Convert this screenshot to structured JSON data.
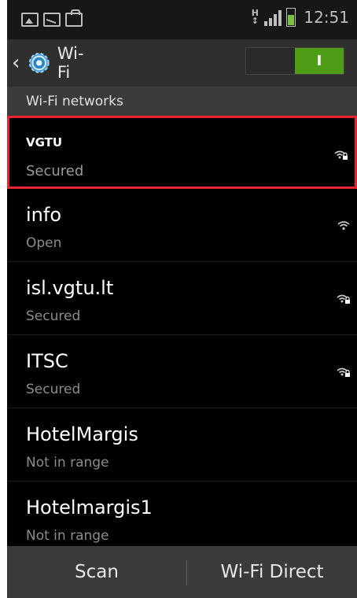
{
  "status_bar": {
    "left_icons": [
      "picture-icon",
      "message-icon",
      "shopping-bag-icon"
    ],
    "network_type": "H",
    "time": "12:51"
  },
  "action_bar": {
    "title": "Wi-Fi",
    "toggle_state": "I",
    "toggle_color": "#4f9c16"
  },
  "section": {
    "header": "Wi-Fi networks"
  },
  "networks": [
    {
      "name": "VGTU",
      "status": "Secured",
      "secured": true,
      "selected": true
    },
    {
      "name": "info",
      "status": "Open",
      "secured": false,
      "selected": false
    },
    {
      "name": "isl.vgtu.lt",
      "status": "Secured",
      "secured": true,
      "selected": false
    },
    {
      "name": "ITSC",
      "status": "Secured",
      "secured": true,
      "selected": false
    },
    {
      "name": "HotelMargis",
      "status": "Not in range",
      "secured": false,
      "selected": false
    },
    {
      "name": "Hotelmargis1",
      "status": "Not in range",
      "secured": false,
      "selected": false
    }
  ],
  "bottom_bar": {
    "scan_label": "Scan",
    "wifi_direct_label": "Wi-Fi Direct"
  },
  "colors": {
    "selection_border": "#e8222e",
    "background": "#000000"
  }
}
